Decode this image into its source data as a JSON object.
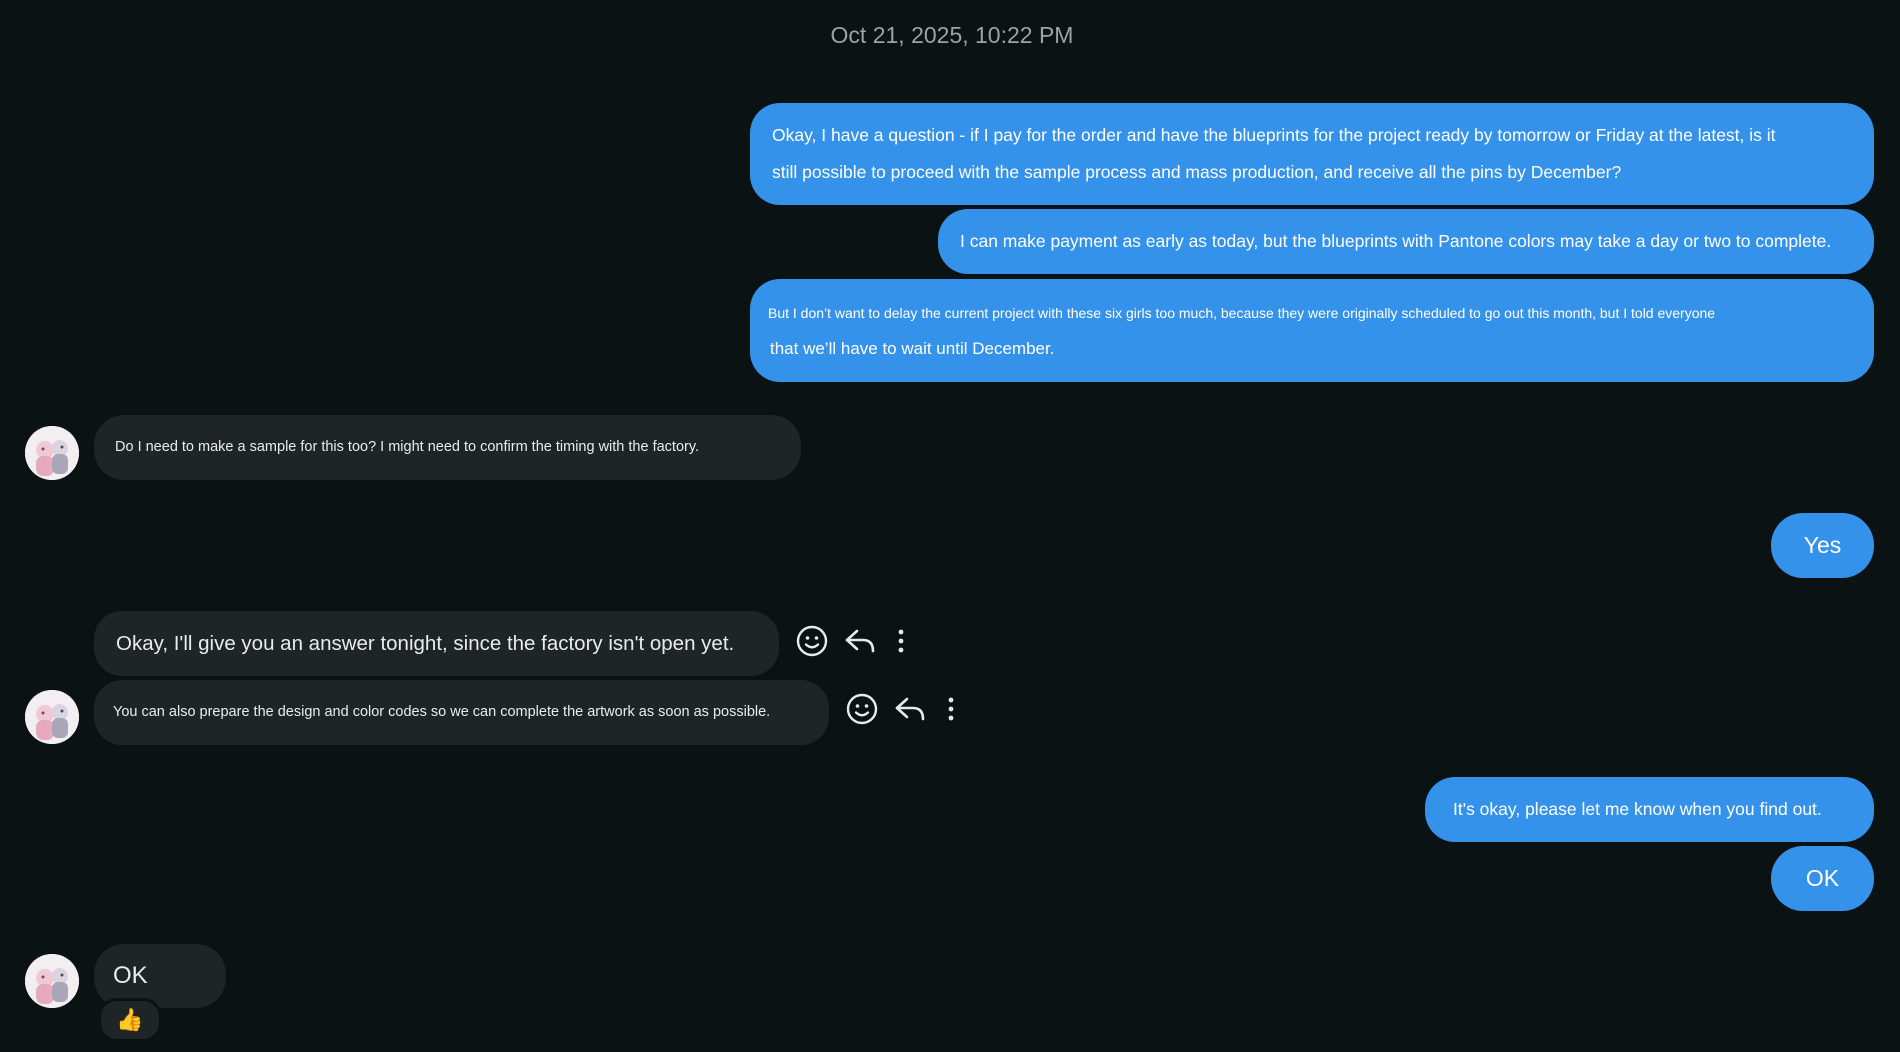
{
  "conversation": {
    "timestamp": "Oct 21, 2025, 10:22 PM",
    "messages": [
      {
        "id": "m1",
        "sender": "me",
        "lines": [
          "Okay, I have a question - if I pay for the order and have the blueprints for the project ready by tomorrow or Friday at the latest, is it",
          "still possible to proceed with the sample process and mass production, and receive all the pins by December?"
        ]
      },
      {
        "id": "m2",
        "sender": "me",
        "text": "I can make payment as early as today, but the blueprints with Pantone colors may take a day or two to complete."
      },
      {
        "id": "m3",
        "sender": "me",
        "lines": [
          "But I don’t want to delay the current project with these six girls too much, because they were originally scheduled to go out this month, but I told everyone",
          "that we’ll have to wait until December."
        ]
      },
      {
        "id": "m4",
        "sender": "contact",
        "text": "Do I need to make a sample for this too? I might need to confirm the timing with the factory."
      },
      {
        "id": "m5",
        "sender": "me",
        "text": "Yes"
      },
      {
        "id": "m6",
        "sender": "contact",
        "text": "Okay, I'll give you an answer tonight, since the factory isn't open yet."
      },
      {
        "id": "m7",
        "sender": "contact",
        "text": "You can also prepare the design and color codes so we can complete the artwork as soon as possible."
      },
      {
        "id": "m8",
        "sender": "me",
        "text": "It's okay, please let me know when you find out."
      },
      {
        "id": "m9",
        "sender": "me",
        "text": "OK"
      },
      {
        "id": "m10",
        "sender": "contact",
        "text": "OK",
        "reaction": "👍"
      }
    ]
  },
  "message_actions": {
    "icons": [
      "emoji-react-icon",
      "reply-icon",
      "more-options-icon"
    ]
  },
  "colors": {
    "background": "#0a1214",
    "outgoing_bubble": "#3592ea",
    "incoming_bubble": "#1f2426",
    "timestamp_text": "#9aa3a7"
  }
}
